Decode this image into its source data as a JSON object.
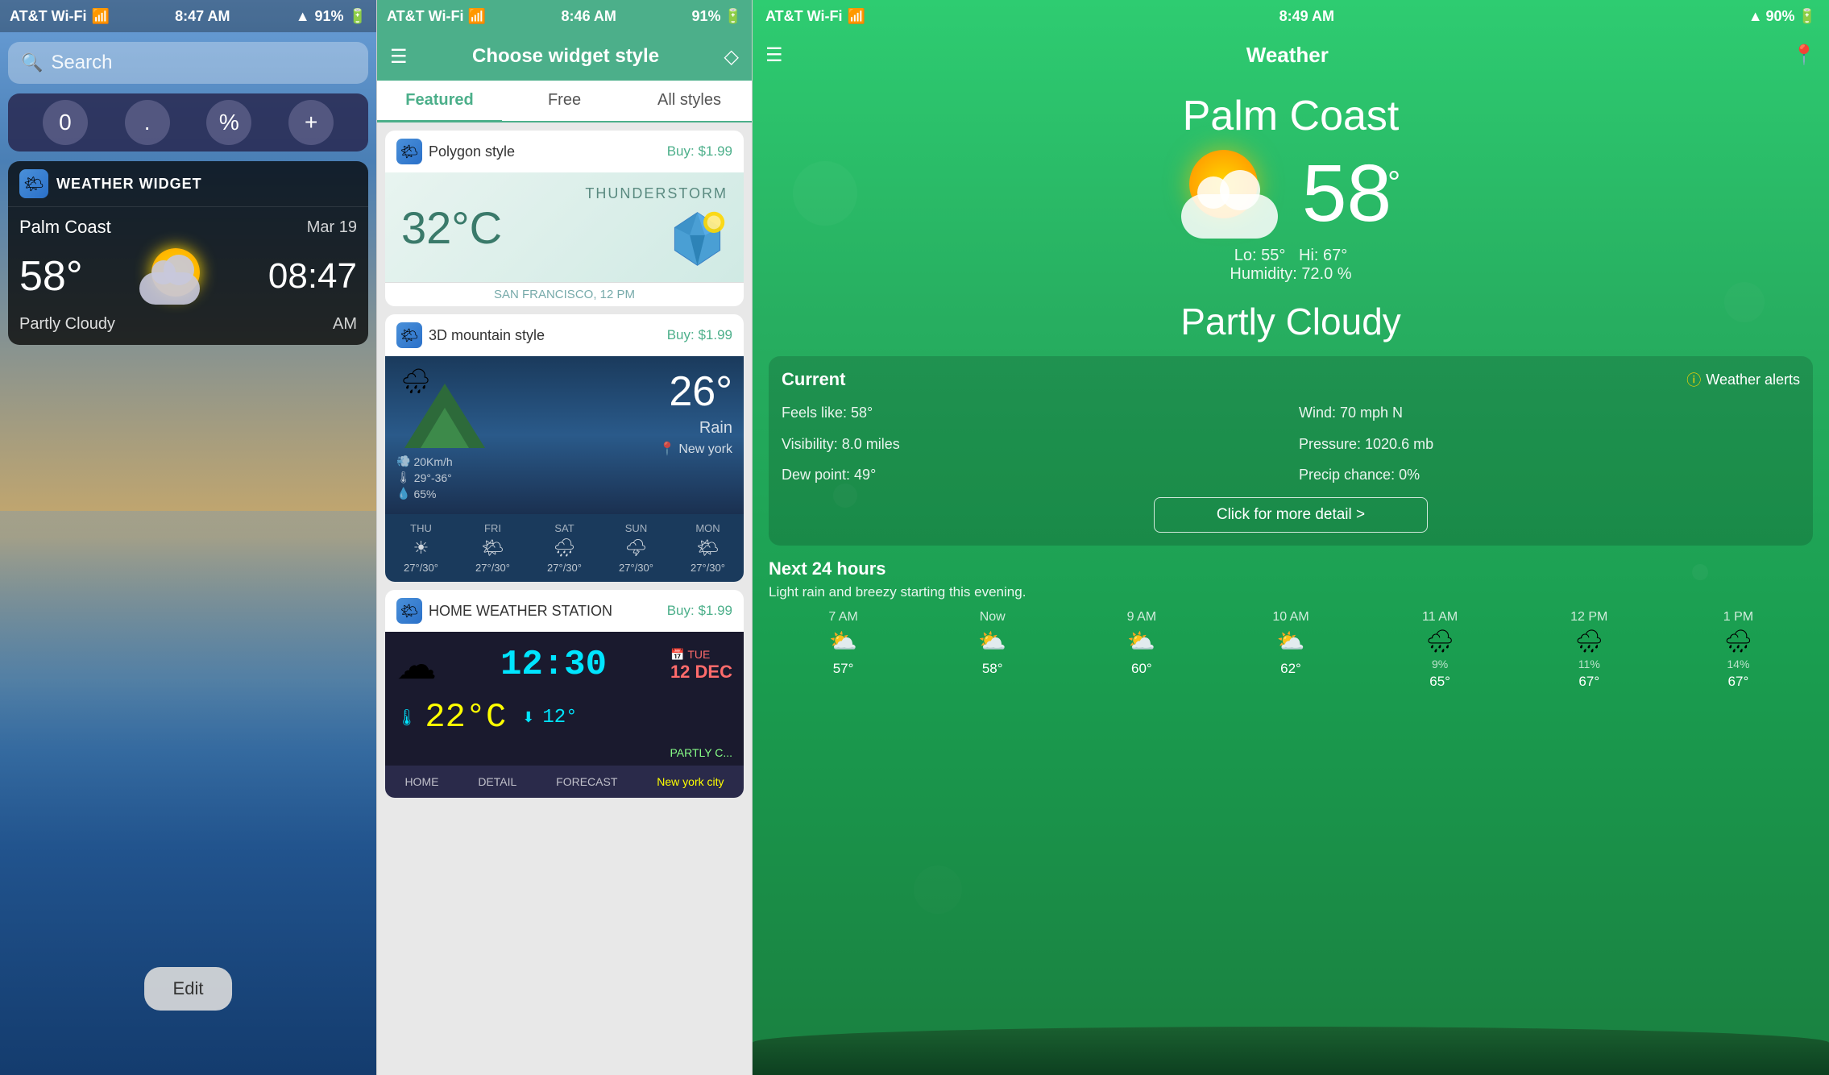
{
  "panel1": {
    "status": {
      "carrier": "AT&T Wi-Fi",
      "time": "8:47 AM",
      "battery": "91%",
      "signal": "▲"
    },
    "search": {
      "placeholder": "Search"
    },
    "calc": {
      "btn1": "0",
      "btn2": ".",
      "btn3": "%",
      "btn4": "+"
    },
    "widget": {
      "title": "WEATHER WIDGET",
      "location": "Palm Coast",
      "date": "Mar 19",
      "temp": "58°",
      "time": "08:47",
      "condition": "Partly Cloudy",
      "ampm": "AM"
    },
    "edit_label": "Edit"
  },
  "panel2": {
    "status": {
      "carrier": "AT&T Wi-Fi",
      "time": "8:46 AM",
      "battery": "91%"
    },
    "header": {
      "title": "Choose widget style",
      "menu_icon": "☰",
      "gem_icon": "◇"
    },
    "tabs": [
      {
        "label": "Featured",
        "active": true
      },
      {
        "label": "Free",
        "active": false
      },
      {
        "label": "All styles",
        "active": false
      }
    ],
    "cards": [
      {
        "name": "Polygon style",
        "price": "Buy: $1.99",
        "temp": "32°C",
        "condition": "THUNDERSTORM",
        "location": "SAN FRANCISCO, 12 PM"
      },
      {
        "name": "3D mountain style",
        "price": "Buy: $1.99",
        "temp": "26°",
        "condition": "Rain",
        "wind": "20Km/h",
        "temp_range": "29°-36°",
        "humidity": "65%",
        "location": "New york",
        "forecast": [
          {
            "day": "THU",
            "temps": "27°/30°",
            "icon": "☀"
          },
          {
            "day": "FRI",
            "temps": "27°/30°",
            "icon": "🌤"
          },
          {
            "day": "SAT",
            "temps": "27°/30°",
            "icon": "🌧"
          },
          {
            "day": "SUN",
            "temps": "27°/30°",
            "icon": "🌩"
          },
          {
            "day": "MON",
            "temps": "27°/30°",
            "icon": "🌤"
          }
        ]
      },
      {
        "name": "HOME WEATHER STATION",
        "price": "Buy: $1.99",
        "time": "12:30",
        "date_label": "TUE",
        "date_val": "12 DEC",
        "temp": "22°C",
        "temp_low": "12°",
        "location": "New york city",
        "nav": [
          "HOME",
          "DETAIL",
          "FORECAST"
        ]
      }
    ]
  },
  "panel3": {
    "status": {
      "carrier": "AT&T Wi-Fi",
      "time": "8:49 AM",
      "battery": "90%"
    },
    "header": {
      "title": "Weather",
      "menu_icon": "☰",
      "location_icon": "📍"
    },
    "city": "Palm Coast",
    "temp": "58",
    "temp_unit": "°",
    "lo": "55°",
    "hi": "67°",
    "humidity": "72.0 %",
    "condition": "Partly Cloudy",
    "current": {
      "title": "Current",
      "alerts_label": "Weather alerts",
      "feels_like": "Feels like: 58°",
      "wind": "Wind: 70 mph N",
      "visibility": "Visibility: 8.0 miles",
      "pressure": "Pressure: 1020.6 mb",
      "dew_point": "Dew point: 49°",
      "precip": "Precip chance: 0%"
    },
    "detail_btn": "Click for more detail >",
    "next24": {
      "title": "Next 24 hours",
      "description": "Light rain and breezy starting this evening.",
      "hours": [
        {
          "label": "7 AM",
          "icon": "⛅",
          "precip": "",
          "temp": "57°"
        },
        {
          "label": "Now",
          "icon": "⛅",
          "precip": "",
          "temp": "58°"
        },
        {
          "label": "9 AM",
          "icon": "⛅",
          "precip": "",
          "temp": "60°"
        },
        {
          "label": "10 AM",
          "icon": "⛅",
          "precip": "",
          "temp": "62°"
        },
        {
          "label": "11 AM",
          "icon": "🌧",
          "precip": "9%",
          "temp": "65°"
        },
        {
          "label": "12 PM",
          "icon": "🌧",
          "precip": "11%",
          "temp": "67°"
        },
        {
          "label": "1 PM",
          "icon": "🌧",
          "precip": "14%",
          "temp": "67°"
        }
      ]
    }
  }
}
